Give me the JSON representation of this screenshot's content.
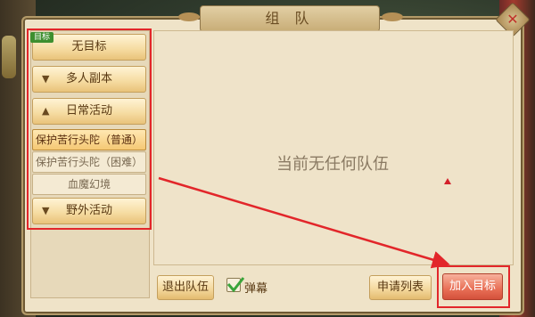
{
  "window": {
    "title": "组 队",
    "close_icon": "close-icon"
  },
  "sidebar": {
    "target_badge": "目标",
    "items": [
      {
        "label": "无目标",
        "type": "category",
        "expandable": false
      },
      {
        "label": "多人副本",
        "type": "category",
        "icon": "chevron-down-icon"
      },
      {
        "label": "日常活动",
        "type": "category",
        "icon": "chevron-up-icon",
        "expanded": true
      },
      {
        "label": "保护苦行头陀（普通）",
        "type": "sub",
        "selected": true
      },
      {
        "label": "保护苦行头陀（困难）",
        "type": "sub",
        "selected": false
      },
      {
        "label": "血魔幻境",
        "type": "sub",
        "selected": false
      },
      {
        "label": "野外活动",
        "type": "category",
        "icon": "chevron-down-icon"
      }
    ]
  },
  "main": {
    "empty_message": "当前无任何队伍"
  },
  "footer": {
    "leave_team": "退出队伍",
    "barrage_label": "弹幕",
    "barrage_checked": true,
    "apply_list": "申请列表",
    "join_target": "加入目标"
  },
  "colors": {
    "highlight_box": "#e2262a",
    "arrow": "#e2262a",
    "panel_bg": "#efe3c8"
  }
}
